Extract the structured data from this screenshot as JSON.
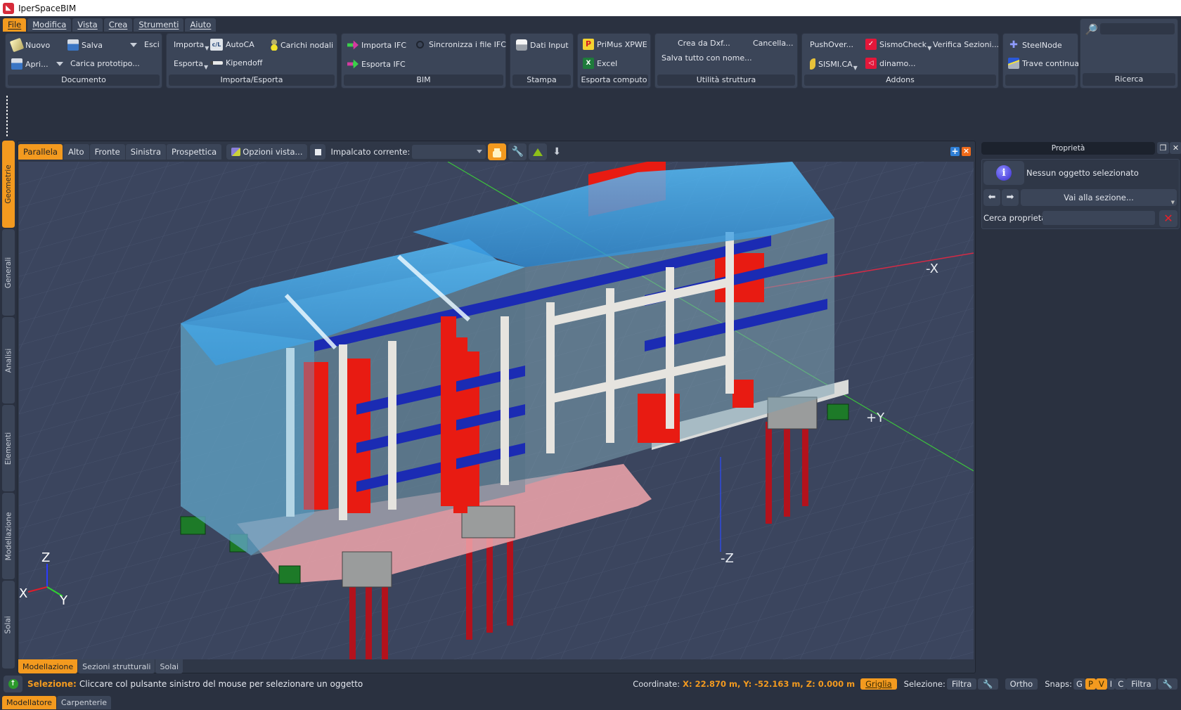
{
  "app": {
    "title": "IperSpaceBIM"
  },
  "menu": [
    {
      "label": "File",
      "active": true
    },
    {
      "label": "Modifica"
    },
    {
      "label": "Vista"
    },
    {
      "label": "Crea"
    },
    {
      "label": "Strumenti"
    },
    {
      "label": "Aiuto"
    }
  ],
  "ribbon": {
    "documento": {
      "label": "Documento",
      "nuovo": "Nuovo",
      "salva": "Salva",
      "esci": "Esci",
      "apri": "Apri...",
      "carica": "Carica prototipo..."
    },
    "importa_esporta": {
      "label": "Importa/Esporta",
      "importa": "Importa",
      "esporta": "Esporta",
      "autocad": "AutoCA",
      "kipendoff": "Kipendoff",
      "carichi": "Carichi nodali"
    },
    "bim": {
      "label": "BIM",
      "importa_ifc": "Importa IFC",
      "esporta_ifc": "Esporta IFC",
      "sincronizza": "Sincronizza i file IFC"
    },
    "stampa": {
      "label": "Stampa",
      "dati_input": "Dati Input"
    },
    "esporta_computo": {
      "label": "Esporta computo",
      "primus": "PriMus XPWE",
      "excel": "Excel"
    },
    "utilita": {
      "label": "Utilità struttura",
      "crea_dxf": "Crea da Dxf...",
      "cancella": "Cancella...",
      "salva_tutto": "Salva tutto con nome..."
    },
    "addons": {
      "label": "Addons",
      "pushover": "PushOver...",
      "sismocheck": "SismoCheck",
      "verifica": "Verifica Sezioni...",
      "sismica": "SISMI.CA",
      "dinamo": "dinamo..."
    },
    "steel": {
      "label": "",
      "steelnode": "SteelNode",
      "trave": "Trave continua"
    },
    "ricerca": {
      "label": "Ricerca",
      "placeholder": ""
    }
  },
  "left_tabs": [
    "Geometrie",
    "Generali",
    "Analisi",
    "Elementi",
    "Modellazione",
    "Solai"
  ],
  "left_tabs_active": "Geometrie",
  "view_toolbar": {
    "views": [
      "Parallela",
      "Alto",
      "Fronte",
      "Sinistra",
      "Prospettica"
    ],
    "active_view": "Parallela",
    "options": "Opzioni vista...",
    "impalcato_label": "Impalcato corrente:",
    "impalcato_value": ""
  },
  "viewport": {
    "axis_labels": {
      "neg_x": "-X",
      "pos_y": "+Y",
      "neg_z": "-Z"
    },
    "gizmo": {
      "x": "X",
      "y": "Y",
      "z": "Z"
    }
  },
  "viewport_tabs": [
    "Modellazione",
    "Sezioni strutturali",
    "Solai"
  ],
  "viewport_tabs_active": "Modellazione",
  "properties": {
    "title": "Proprietà",
    "none_selected": "Nessun oggetto selezionato",
    "goto_section": "Vai alla sezione...",
    "search_label": "Cerca proprietà:",
    "search_value": ""
  },
  "status": {
    "label": "Selezione:",
    "message": "Cliccare col pulsante sinistro del mouse per selezionare un oggetto",
    "coord_label": "Coordinate:",
    "coord_value": "X: 22.870 m, Y: -52.163 m, Z: 0.000 m",
    "griglia": "Griglia",
    "selezione_label": "Selezione:",
    "filtra": "Filtra",
    "ortho": "Ortho",
    "snaps_label": "Snaps:",
    "snaps": [
      {
        "key": "G",
        "on": false
      },
      {
        "key": "P",
        "on": true
      },
      {
        "key": "V",
        "on": true
      },
      {
        "key": "I",
        "on": false
      },
      {
        "key": "C",
        "on": false
      }
    ],
    "snaps_filtra": "Filtra"
  },
  "bottom_tabs": [
    "Modellatore",
    "Carpenterie"
  ],
  "bottom_tabs_active": "Modellatore",
  "colors": {
    "accent": "#f39a1f",
    "panel": "#3b4558",
    "background": "#2a3140",
    "viewport": "#3b455e"
  }
}
